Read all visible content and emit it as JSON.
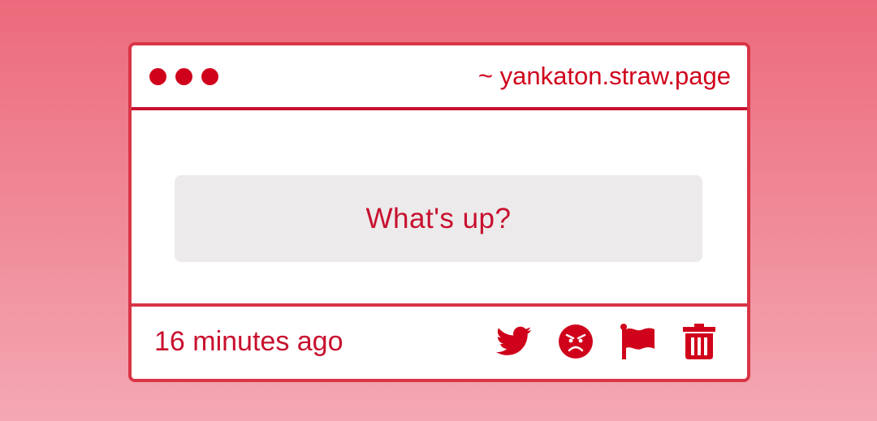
{
  "window": {
    "url": "~ yankaton.straw.page",
    "dots": [
      "dot",
      "dot",
      "dot"
    ]
  },
  "message": {
    "text": "What's up?"
  },
  "footer": {
    "timestamp": "16 minutes ago",
    "actions": [
      {
        "name": "twitter-icon"
      },
      {
        "name": "angry-face-icon"
      },
      {
        "name": "flag-icon"
      },
      {
        "name": "trash-icon"
      }
    ]
  },
  "colors": {
    "accent": "#d0021b",
    "border": "#d93547",
    "message_bg": "#eceaeb",
    "bg_top": "#ec6a7b",
    "bg_bottom": "#f4a8b3"
  }
}
